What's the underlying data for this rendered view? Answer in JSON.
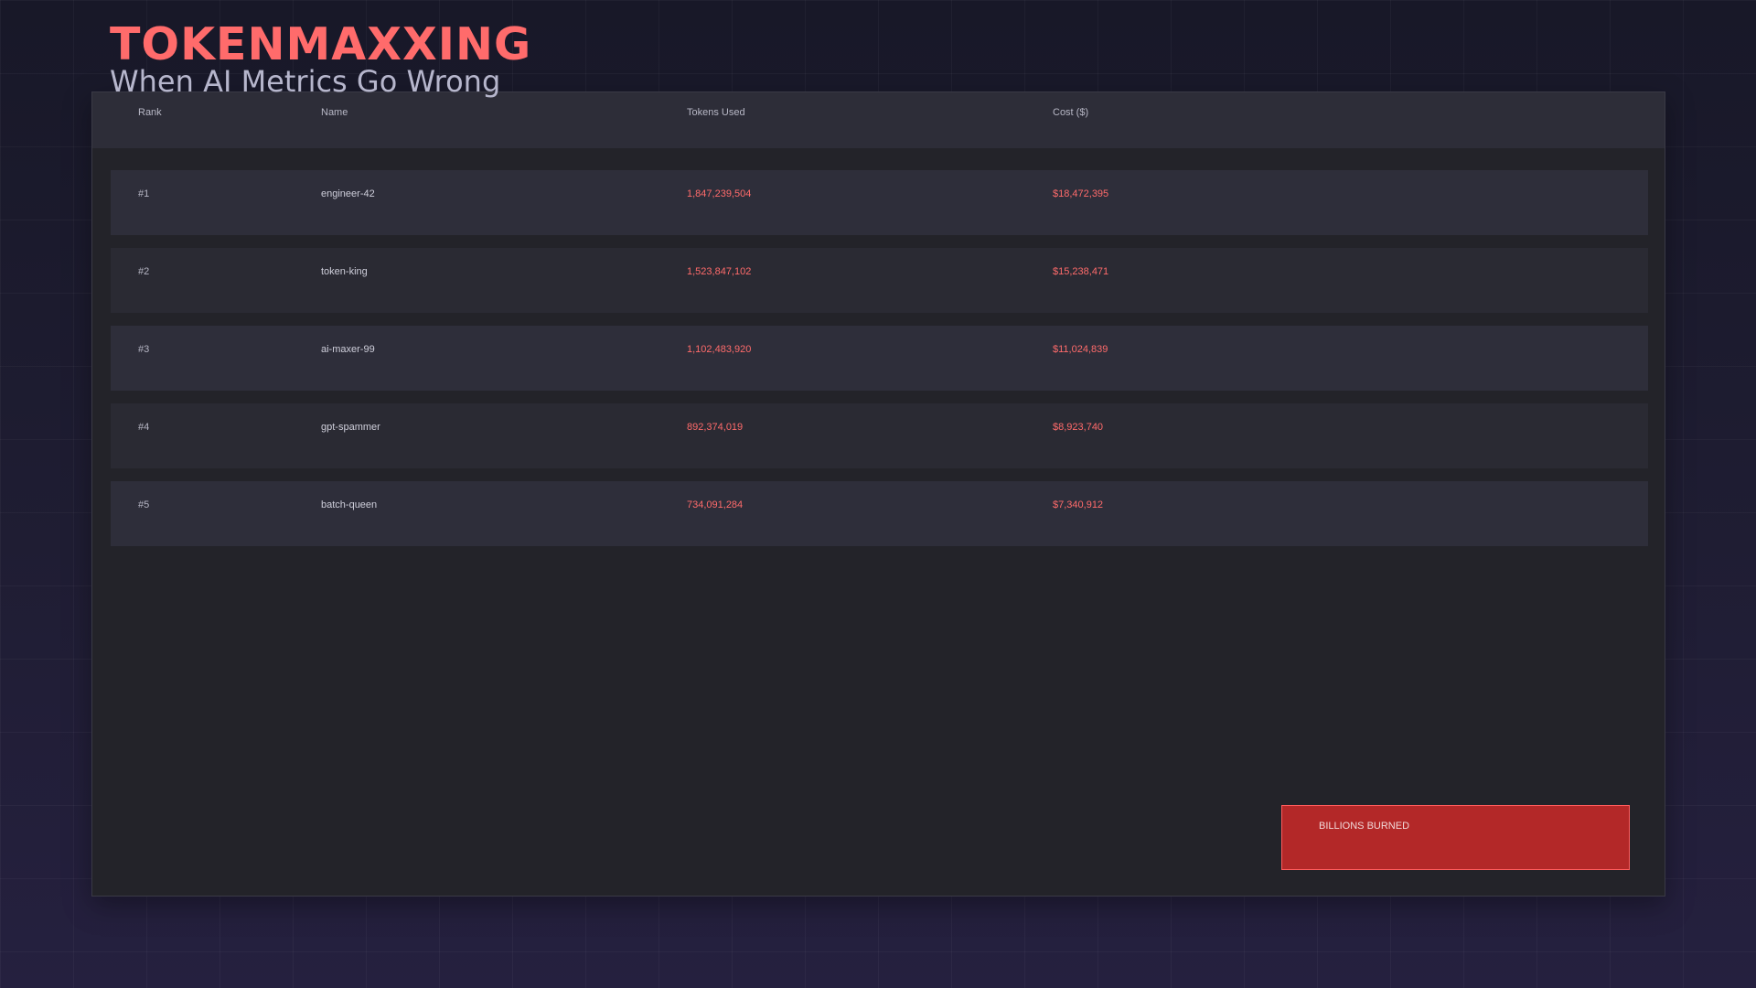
{
  "header": {
    "title": "TOKENMAXXING",
    "subtitle": "When AI Metrics Go Wrong"
  },
  "table": {
    "columns": [
      "Rank",
      "Name",
      "Tokens Used",
      "Cost ($)"
    ],
    "rows": [
      {
        "rank": "#1",
        "name": "engineer-42",
        "tokens": "1,847,239,504",
        "cost": "$18,472,395"
      },
      {
        "rank": "#2",
        "name": "token-king",
        "tokens": "1,523,847,102",
        "cost": "$15,238,471"
      },
      {
        "rank": "#3",
        "name": "ai-maxer-99",
        "tokens": "1,102,483,920",
        "cost": "$11,024,839"
      },
      {
        "rank": "#4",
        "name": "gpt-spammer",
        "tokens": "892,374,019",
        "cost": "$8,923,740"
      },
      {
        "rank": "#5",
        "name": "batch-queen",
        "tokens": "734,091,284",
        "cost": "$7,340,912"
      }
    ]
  },
  "callout": {
    "label": "BILLIONS BURNED"
  },
  "colors": {
    "accent": "#ff6b6b",
    "callout_bg": "#b32828",
    "panel_bg": "#232329"
  }
}
